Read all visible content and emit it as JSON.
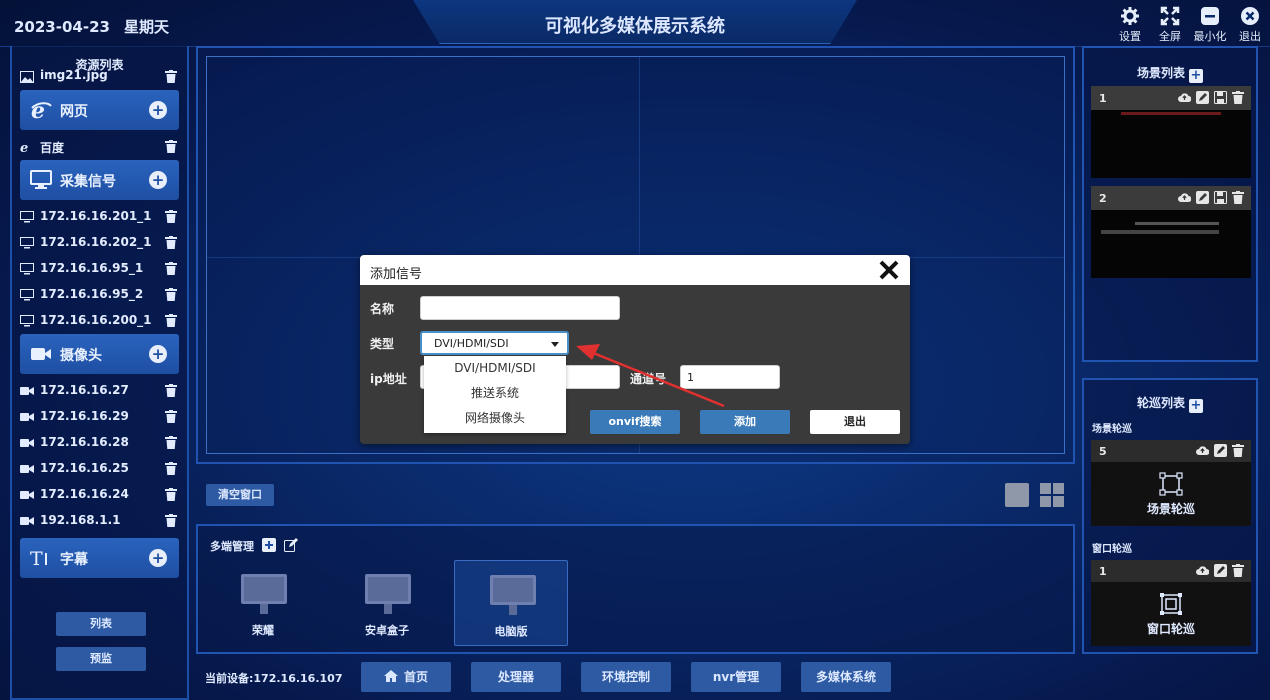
{
  "header": {
    "date": "2023-04-23",
    "weekday": "星期天",
    "title": "可视化多媒体展示系统",
    "buttons": {
      "settings": "设置",
      "fullscreen": "全屏",
      "minimize": "最小化",
      "exit": "退出"
    }
  },
  "resources": {
    "title": "资源列表",
    "image_item": "img21.jpg",
    "web": {
      "label": "网页",
      "items": [
        "百度"
      ]
    },
    "capture": {
      "label": "采集信号",
      "items": [
        "172.16.16.201_1",
        "172.16.16.202_1",
        "172.16.16.95_1",
        "172.16.16.95_2",
        "172.16.16.200_1"
      ]
    },
    "camera": {
      "label": "摄像头",
      "items": [
        "172.16.16.27",
        "172.16.16.29",
        "172.16.16.28",
        "172.16.16.25",
        "172.16.16.24",
        "192.168.1.1"
      ]
    },
    "subtitle": {
      "label": "字幕"
    },
    "list_button": "列表",
    "preview_button": "预监"
  },
  "stage": {
    "clear_button": "清空窗口"
  },
  "multi": {
    "title": "多端管理",
    "devices": [
      "荣耀",
      "安卓盒子",
      "电脑版"
    ]
  },
  "status": {
    "current_device": "当前设备:172.16.16.107"
  },
  "nav": [
    "首页",
    "处理器",
    "环境控制",
    "nvr管理",
    "多媒体系统"
  ],
  "scenes": {
    "title": "场景列表",
    "items": [
      {
        "num": "1"
      },
      {
        "num": "2"
      }
    ]
  },
  "tours": {
    "title": "轮巡列表",
    "scene_tour_label": "场景轮巡",
    "scene_tour": {
      "num": "5",
      "label": "场景轮巡"
    },
    "window_tour_label": "窗口轮巡",
    "window_tour": {
      "num": "1",
      "label": "窗口轮巡"
    }
  },
  "dialog": {
    "title": "添加信号",
    "name_label": "名称",
    "name_value": "",
    "type_label": "类型",
    "type_value": "DVI/HDMI/SDI",
    "ip_label": "ip地址",
    "channel_label": "通道号",
    "channel_value": "1",
    "dropdown_options": [
      "DVI/HDMI/SDI",
      "推送系统",
      "网络摄像头"
    ],
    "onvif_button": "onvif搜索",
    "add_button": "添加",
    "cancel_button": "退出"
  },
  "colors": {
    "background": "#071a4a",
    "panel_border": "#2153b0",
    "button_blue": "#2d5aa2",
    "annotation_arrow": "#e03030",
    "primary_button": "#3a7ab8"
  }
}
